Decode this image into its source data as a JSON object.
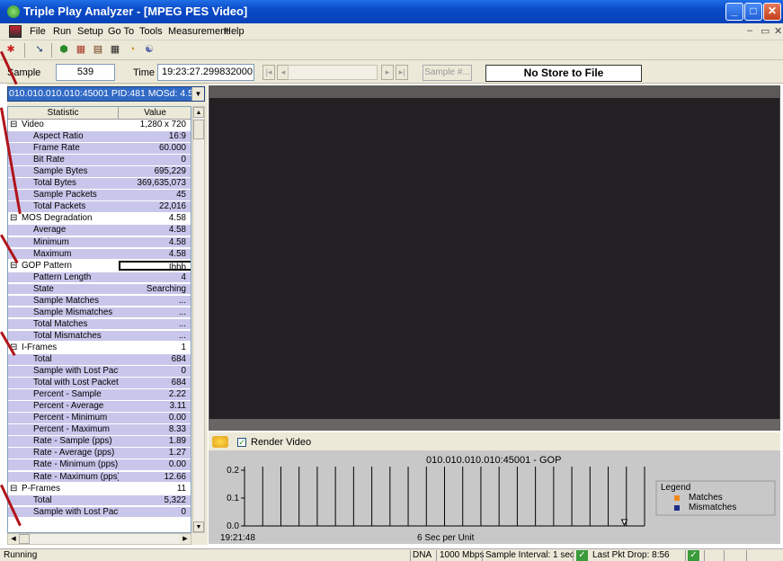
{
  "window": {
    "title": "Triple Play Analyzer - [MPEG PES Video]"
  },
  "menu": {
    "items": [
      "File",
      "Run",
      "Setup",
      "Go To",
      "Tools",
      "Measurement",
      "Help"
    ]
  },
  "sample_bar": {
    "sample_label": "Sample",
    "sample_value": "539",
    "time_label": "Time",
    "time_value": "19:23:27.299832000",
    "sample_btn": "Sample #...",
    "store_label": "No Store to File"
  },
  "stream_selector": "010.010.010.010:45001  PID:481  MOSd: 4.5",
  "stats_table": {
    "headers": [
      "Statistic",
      "Value"
    ],
    "rows": [
      {
        "name": "Video",
        "value": "1,280 x 720",
        "type": "sec"
      },
      {
        "name": "Aspect Ratio",
        "value": "16:9",
        "type": "sub"
      },
      {
        "name": "Frame Rate",
        "value": "60.000",
        "type": "sub"
      },
      {
        "name": "Bit Rate",
        "value": "0",
        "type": "sub"
      },
      {
        "name": "Sample Bytes",
        "value": "695,229",
        "type": "sub"
      },
      {
        "name": "Total Bytes",
        "value": "369,635,073",
        "type": "sub"
      },
      {
        "name": "Sample Packets",
        "value": "45",
        "type": "sub"
      },
      {
        "name": "Total Packets",
        "value": "22,016",
        "type": "sub"
      },
      {
        "name": "MOS Degradation",
        "value": "4.58",
        "type": "sec"
      },
      {
        "name": "Average",
        "value": "4.58",
        "type": "sub"
      },
      {
        "name": "Minimum",
        "value": "4.58",
        "type": "sub"
      },
      {
        "name": "Maximum",
        "value": "4.58",
        "type": "sub"
      },
      {
        "name": "GOP Pattern",
        "value": "Ibbb",
        "type": "sec",
        "selected": true
      },
      {
        "name": "Pattern Length",
        "value": "4",
        "type": "sub"
      },
      {
        "name": "State",
        "value": "Searching",
        "type": "sub"
      },
      {
        "name": "Sample Matches",
        "value": "...",
        "type": "sub"
      },
      {
        "name": "Sample Mismatches",
        "value": "...",
        "type": "sub"
      },
      {
        "name": "Total Matches",
        "value": "...",
        "type": "sub"
      },
      {
        "name": "Total Mismatches",
        "value": "...",
        "type": "sub"
      },
      {
        "name": "I-Frames",
        "value": "1",
        "type": "sec"
      },
      {
        "name": "Total",
        "value": "684",
        "type": "sub"
      },
      {
        "name": "Sample with Lost Pack",
        "value": "0",
        "type": "sub"
      },
      {
        "name": "Total with Lost Packet",
        "value": "684",
        "type": "sub"
      },
      {
        "name": "Percent - Sample",
        "value": "2.22",
        "type": "sub"
      },
      {
        "name": "Percent - Average",
        "value": "3.11",
        "type": "sub"
      },
      {
        "name": "Percent - Minimum",
        "value": "0.00",
        "type": "sub"
      },
      {
        "name": "Percent - Maximum",
        "value": "8.33",
        "type": "sub"
      },
      {
        "name": "Rate - Sample (pps)",
        "value": "1.89",
        "type": "sub"
      },
      {
        "name": "Rate - Average (pps)",
        "value": "1.27",
        "type": "sub"
      },
      {
        "name": "Rate - Minimum (pps)",
        "value": "0.00",
        "type": "sub"
      },
      {
        "name": "Rate - Maximum (pps)",
        "value": "12.66",
        "type": "sub"
      },
      {
        "name": "P-Frames",
        "value": "11",
        "type": "sec"
      },
      {
        "name": "Total",
        "value": "5,322",
        "type": "sub"
      },
      {
        "name": "Sample with Lost Pack",
        "value": "0",
        "type": "sub"
      }
    ]
  },
  "render": {
    "label": "Render Video",
    "checked": true
  },
  "chart_data": {
    "type": "bar",
    "title": "010.010.010.010:45001 - GOP",
    "xlabel": "6 Sec per Unit",
    "x_start_label": "19:21:48",
    "yticks": [
      "0.2",
      "0.1",
      "0.0"
    ],
    "ylim": [
      0,
      0.2
    ],
    "bar_count": 22,
    "legend": {
      "title": "Legend",
      "entries": [
        {
          "name": "Matches",
          "color": "#f08a1c"
        },
        {
          "name": "Mismatches",
          "color": "#1c2e8a"
        }
      ]
    }
  },
  "status": {
    "left": "Running",
    "dna": "DNA",
    "speed": "1000 Mbps",
    "interval": "Sample Interval: 1 sec",
    "lastdrop": "Last Pkt Drop: 8:56"
  }
}
